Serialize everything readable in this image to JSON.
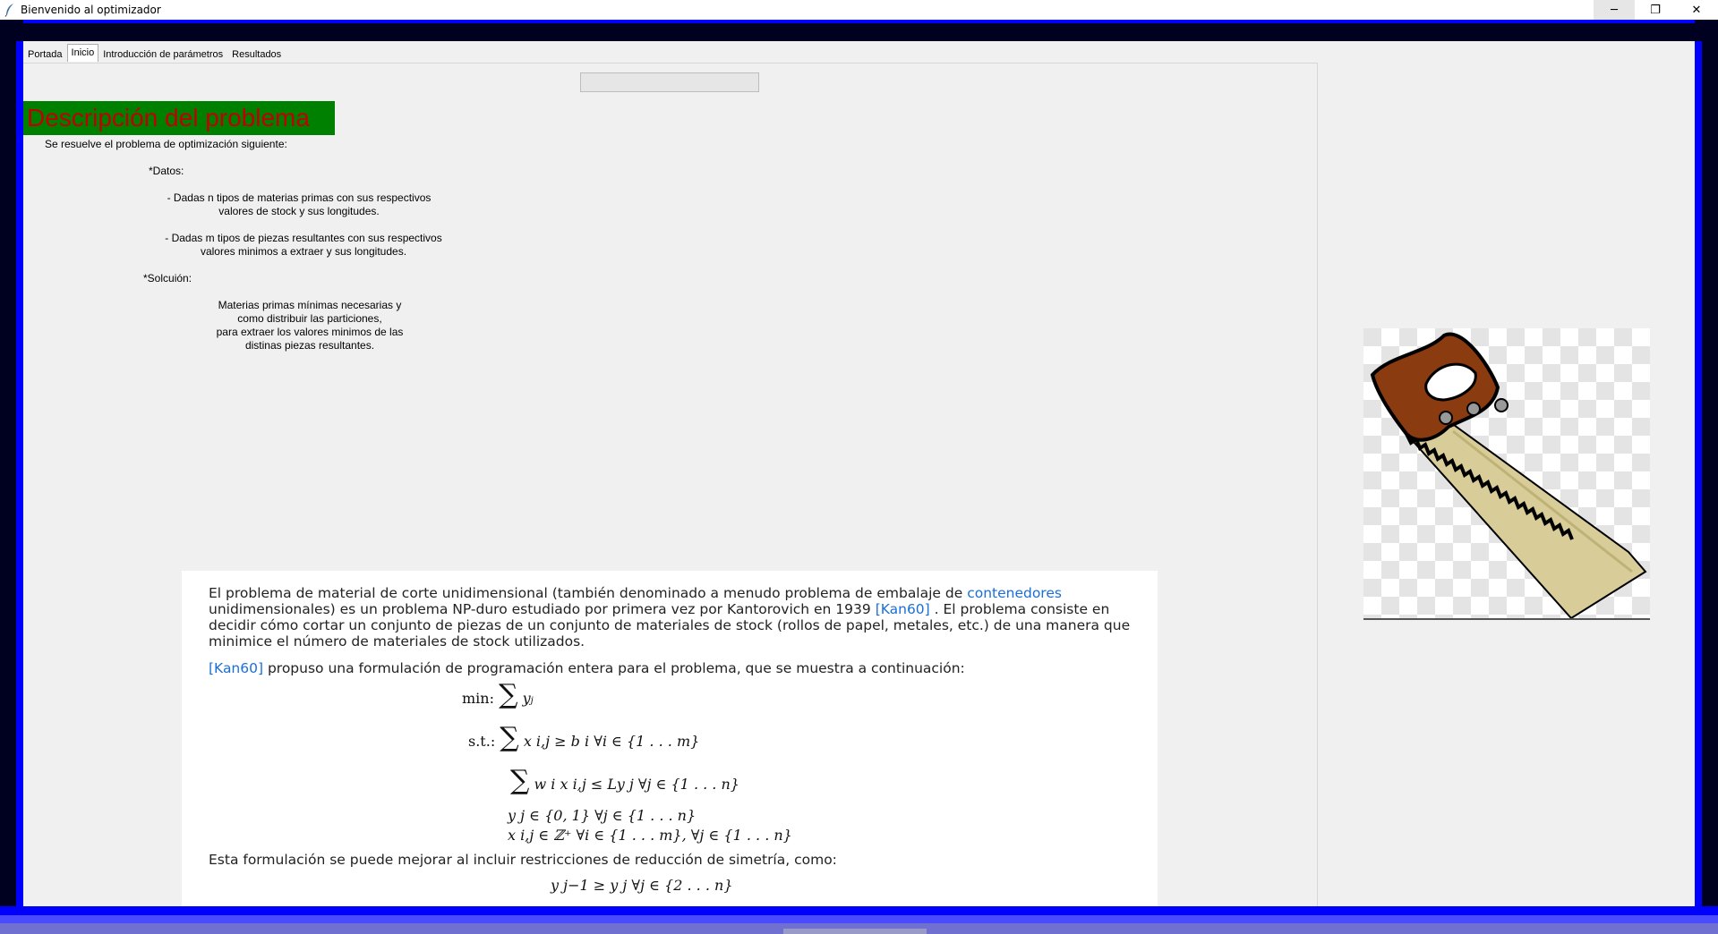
{
  "window": {
    "title": "Bienvenido al optimizador",
    "minimize_glyph": "─",
    "maximize_glyph": "❐",
    "close_glyph": "✕"
  },
  "tabs": [
    {
      "label": "Portada",
      "active": false
    },
    {
      "label": "Inicio",
      "active": true
    },
    {
      "label": "Introducción de parámetros",
      "active": false
    },
    {
      "label": "Resultados",
      "active": false
    }
  ],
  "inicio": {
    "heading": "Descripción del problema",
    "intro": "Se resuelve el problema de optimización siguiente:",
    "datos_label": "*Datos:",
    "datos_1_line1": "- Dadas n tipos de materias primas con sus respectivos",
    "datos_1_line2": "valores de stock y sus longitudes.",
    "datos_2_line1": "- Dadas m tipos de piezas resultantes con sus respectivos",
    "datos_2_line2": "valores minimos a extraer y sus longitudes.",
    "solucion_label": "*Solcuión:",
    "solucion_line1": "Materias primas mínimas necesarias y",
    "solucion_line2": "como distribuir las particiones,",
    "solucion_line3": "para extraer los valores minimos de las",
    "solucion_line4": "distinas piezas resultantes."
  },
  "formula_panel": {
    "p1_a": "El problema de material de corte unidimensional (también denominado a menudo problema de embalaje de ",
    "p1_link": "contenedores",
    "p1_b": " unidimensionales) es un problema NP-duro estudiado por primera vez por Kantorovich en 1939 ",
    "p1_ref": "[Kan60]",
    "p1_c": " . El problema consiste en decidir cómo cortar un conjunto de piezas de un conjunto de materiales de stock (rollos de papel, metales, etc.) de una manera que minimice el número de materiales de stock utilizados.",
    "p2_ref": "[Kan60]",
    "p2_text": " propuso una formulación de programación entera para el problema, que se muestra a continuación:",
    "eq1_label": "min:",
    "eq1_body": "y",
    "eq2_label": "s.t.:",
    "eq2_body": "x i,j ≥ b i   ∀i ∈ {1 . . . m}",
    "eq3_body": "w i x i,j ≤ Ly j   ∀j ∈ {1 . . . n}",
    "eq4_body": "y j ∈ {0, 1}   ∀j ∈ {1 . . . n}",
    "eq5_body": "x i,j ∈ ℤ⁺   ∀i ∈ {1 . . . m}, ∀j ∈ {1 . . . n}",
    "p3": "Esta formulación se puede mejorar al incluir restricciones de reducción de simetría, como:",
    "eq6_body": "y j−1 ≥ y j   ∀j ∈ {2 . . . n}"
  },
  "colors": {
    "heading_bg": "#008000",
    "heading_fg": "#c00000",
    "frame_blue": "#0000ff",
    "link": "#1a6ed8"
  }
}
